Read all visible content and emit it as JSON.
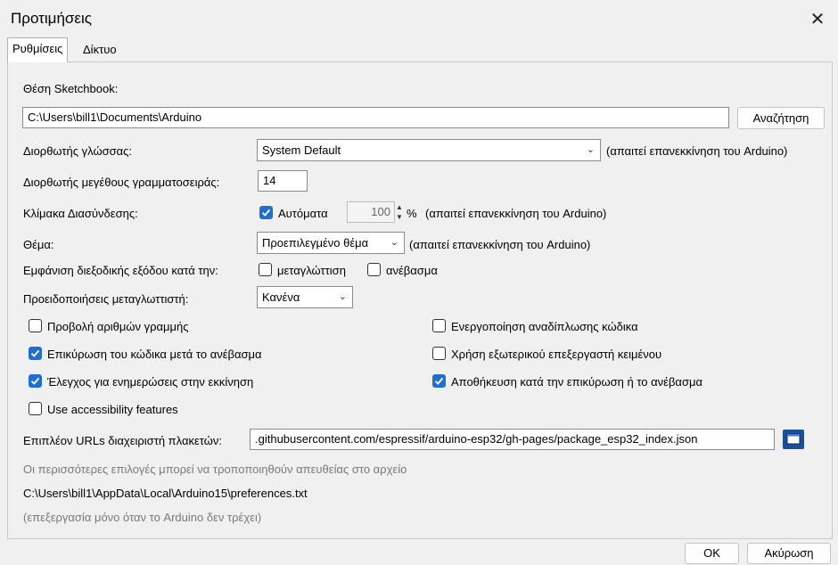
{
  "window": {
    "title": "Προτιμήσεις",
    "close_glyph": "✕"
  },
  "tabs": [
    {
      "label": "Ρυθμίσεις",
      "active": true
    },
    {
      "label": "Δίκτυο",
      "active": false
    }
  ],
  "sketchbook": {
    "label": "Θέση Sketchbook:",
    "path": "C:\\Users\\bill1\\Documents\\Arduino",
    "browse_label": "Αναζήτηση"
  },
  "language": {
    "label": "Διορθωτής γλώσσας:",
    "value": "System Default",
    "note": "(απαιτεί επανεκκίνηση του Arduino)"
  },
  "font_size": {
    "label": "Διορθωτής μεγέθους γραμματοσειράς:",
    "value": "14"
  },
  "scale": {
    "label": "Κλίμακα Διασύνδεσης:",
    "auto_label": "Αυτόματα",
    "auto_checked": true,
    "value": "100",
    "spin_glyph": "▲\n▼",
    "percent": "%",
    "note": "(απαιτεί επανεκκίνηση του Arduino)"
  },
  "theme": {
    "label": "Θέμα:",
    "value": "Προεπιλεγμένο θέμα",
    "note": "(απαιτεί επανεκκίνηση του Arduino)"
  },
  "verbose": {
    "label": "Εμφάνιση διεξοδικής εξόδου κατά την:",
    "compile_label": "μεταγλώττιση",
    "compile_checked": false,
    "upload_label": "ανέβασμα",
    "upload_checked": false
  },
  "warnings": {
    "label": "Προειδοποιήσεις μεταγλωττιστή:",
    "value": "Κανένα"
  },
  "options_left": [
    {
      "label": "Προβολή αριθμών γραμμής",
      "checked": false
    },
    {
      "label": "Επικύρωση του κώδικα μετά το ανέβασμα",
      "checked": true
    },
    {
      "label": "Έλεγχος για ενημερώσεις στην εκκίνηση",
      "checked": true
    },
    {
      "label": "Use accessibility features",
      "checked": false
    }
  ],
  "options_right": [
    {
      "label": "Ενεργοποίηση αναδίπλωσης κώδικα",
      "checked": false
    },
    {
      "label": "Χρήση εξωτερικού επεξεργαστή κειμένου",
      "checked": false
    },
    {
      "label": "Αποθήκευση κατά την επικύρωση ή το ανέβασμα",
      "checked": true
    }
  ],
  "board_urls": {
    "label": "Επιπλέον URLs διαχειριστή πλακετών:",
    "value": ".githubusercontent.com/espressif/arduino-esp32/gh-pages/package_esp32_index.json",
    "edit_icon": "window-edit-icon"
  },
  "footer_info": {
    "line1": "Οι περισσότερες επιλογές μπορεί να τροποποιηθούν απευθείας στο αρχείο",
    "path": "C:\\Users\\bill1\\AppData\\Local\\Arduino15\\preferences.txt",
    "line3": "(επεξεργασία μόνο όταν το Arduino δεν τρέχει)"
  },
  "buttons": {
    "ok": "OK",
    "cancel": "Ακύρωση"
  },
  "colors": {
    "accent": "#1f6fd1",
    "muted_text": "#7a7a7a",
    "background": "#f0f0f0"
  }
}
